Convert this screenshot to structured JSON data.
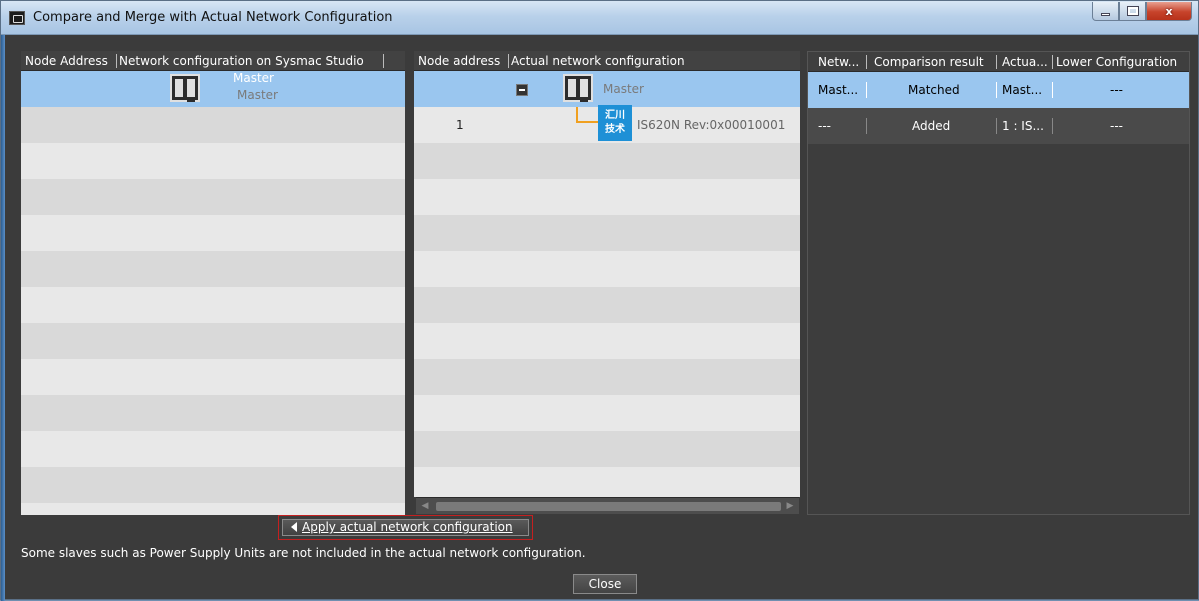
{
  "window": {
    "title": "Compare and Merge with Actual Network Configuration",
    "controls": {
      "minimize": "minimize-icon",
      "maximize": "maximize-icon",
      "close_glyph": "x"
    }
  },
  "left_panel": {
    "headers": [
      "Node Address",
      "Network configuration on Sysmac Studio"
    ],
    "rows": [
      {
        "address": "",
        "device": "Master",
        "device_sub": "Master",
        "icon": "controller-node-icon",
        "selected": true
      }
    ]
  },
  "middle_panel": {
    "headers": [
      "Node address",
      "Actual network configuration"
    ],
    "rows": [
      {
        "address": "",
        "device": "Master",
        "icon": "controller-node-icon",
        "selected": true
      },
      {
        "address": "1",
        "device": "IS620N Rev:0x00010001",
        "icon_text": [
          "汇川",
          "技术"
        ],
        "icon": "servo-drive-icon"
      }
    ]
  },
  "right_panel": {
    "headers": [
      "Netw...",
      "Comparison result",
      "Actua...",
      "Lower Configuration"
    ],
    "rows": [
      {
        "network": "Mast...",
        "result": "Matched",
        "actual": "Mast...",
        "lower": "---",
        "selected": true
      },
      {
        "network": "---",
        "result": "Added",
        "actual": "1 : IS...",
        "lower": "---",
        "selected": false
      }
    ]
  },
  "actions": {
    "apply_label": "Apply actual network configuration",
    "close_label": "Close"
  },
  "note": "Some slaves such as Power Supply Units are not included in the actual network configuration.",
  "colors": {
    "selected_row": "#9ac6ef",
    "dark_row": "#4a4a4a",
    "highlight_border": "#c42020",
    "drive_icon": "#1e90d6"
  }
}
